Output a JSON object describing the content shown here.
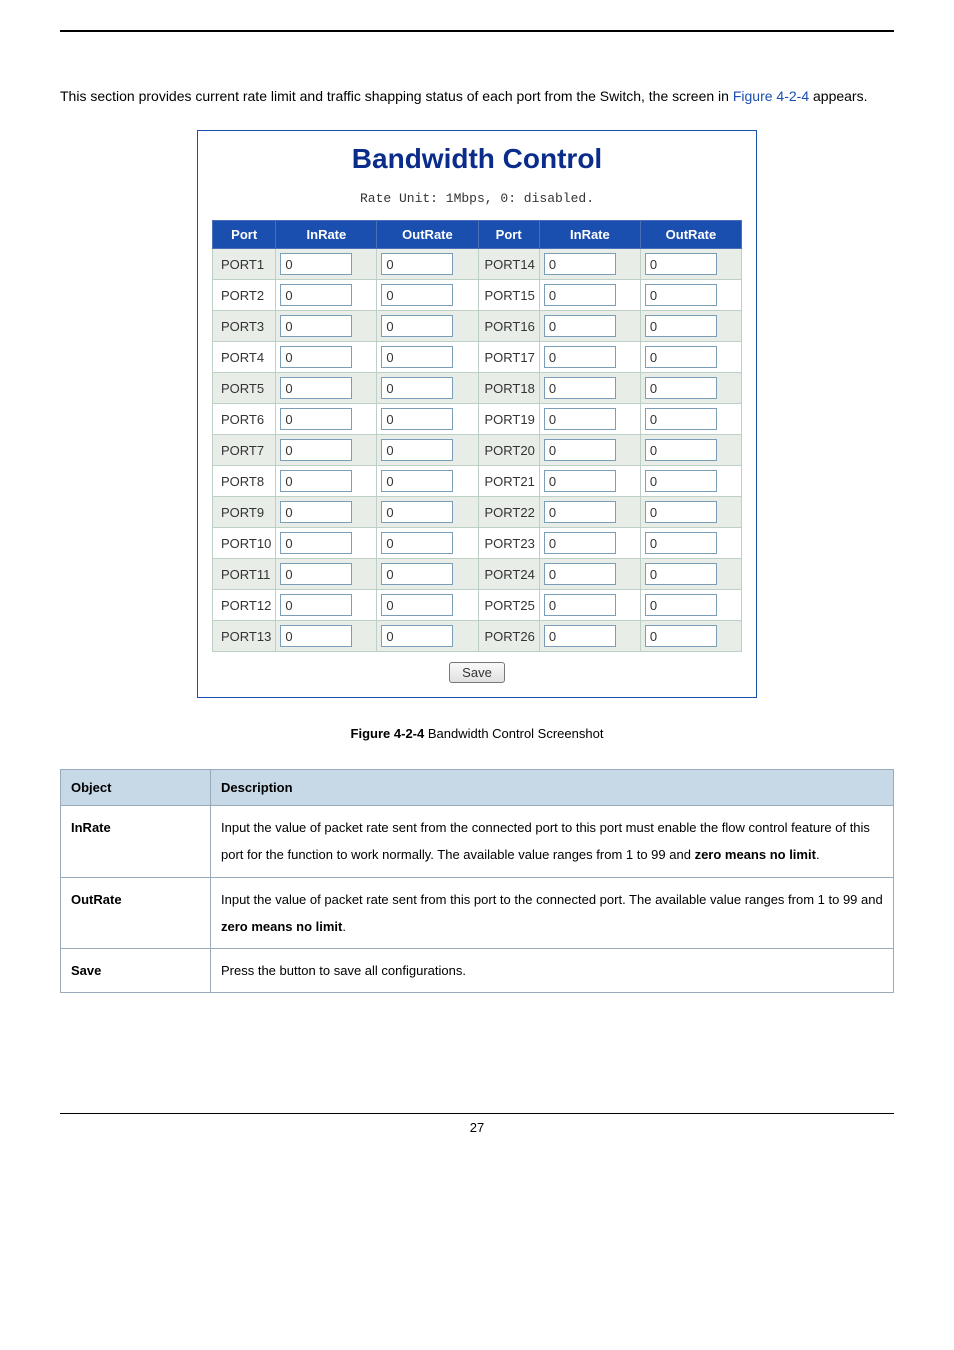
{
  "intro": {
    "prefix": "This section provides current rate limit and traffic shapping status of each port from the Switch, the screen in ",
    "figlink": "Figure 4-2-4",
    "suffix": " appears."
  },
  "panel": {
    "title": "Bandwidth Control",
    "rate_unit": "Rate Unit: 1Mbps, 0: disabled.",
    "headers": {
      "port": "Port",
      "inrate": "InRate",
      "outrate": "OutRate"
    },
    "rows_left": [
      {
        "port": "PORT1",
        "in": "0",
        "out": "0"
      },
      {
        "port": "PORT2",
        "in": "0",
        "out": "0"
      },
      {
        "port": "PORT3",
        "in": "0",
        "out": "0"
      },
      {
        "port": "PORT4",
        "in": "0",
        "out": "0"
      },
      {
        "port": "PORT5",
        "in": "0",
        "out": "0"
      },
      {
        "port": "PORT6",
        "in": "0",
        "out": "0"
      },
      {
        "port": "PORT7",
        "in": "0",
        "out": "0"
      },
      {
        "port": "PORT8",
        "in": "0",
        "out": "0"
      },
      {
        "port": "PORT9",
        "in": "0",
        "out": "0"
      },
      {
        "port": "PORT10",
        "in": "0",
        "out": "0"
      },
      {
        "port": "PORT11",
        "in": "0",
        "out": "0"
      },
      {
        "port": "PORT12",
        "in": "0",
        "out": "0"
      },
      {
        "port": "PORT13",
        "in": "0",
        "out": "0"
      }
    ],
    "rows_right": [
      {
        "port": "PORT14",
        "in": "0",
        "out": "0"
      },
      {
        "port": "PORT15",
        "in": "0",
        "out": "0"
      },
      {
        "port": "PORT16",
        "in": "0",
        "out": "0"
      },
      {
        "port": "PORT17",
        "in": "0",
        "out": "0"
      },
      {
        "port": "PORT18",
        "in": "0",
        "out": "0"
      },
      {
        "port": "PORT19",
        "in": "0",
        "out": "0"
      },
      {
        "port": "PORT20",
        "in": "0",
        "out": "0"
      },
      {
        "port": "PORT21",
        "in": "0",
        "out": "0"
      },
      {
        "port": "PORT22",
        "in": "0",
        "out": "0"
      },
      {
        "port": "PORT23",
        "in": "0",
        "out": "0"
      },
      {
        "port": "PORT24",
        "in": "0",
        "out": "0"
      },
      {
        "port": "PORT25",
        "in": "0",
        "out": "0"
      },
      {
        "port": "PORT26",
        "in": "0",
        "out": "0"
      }
    ],
    "save_label": "Save"
  },
  "fig_caption_prefix": "Figure 4-2-4",
  "fig_caption_text": " Bandwidth Control Screenshot",
  "desc_table": {
    "h_obj": "Object",
    "h_desc": "Description",
    "rows": [
      {
        "obj": "InRate",
        "desc": "Input the value of packet rate sent from the connected port to this port must enable the flow control feature of this port for the function to work normally. The available value ranges from 1 to 99 and ",
        "bold": "zero means no limit",
        "end": "."
      },
      {
        "obj": "OutRate",
        "desc": "Input the value of packet rate sent from this port to the connected port. The available value ranges from 1 to 99 and ",
        "bold": "zero means no limit",
        "end": "."
      },
      {
        "obj": "Save",
        "desc": "Press the button to save all configurations.",
        "bold": "",
        "end": ""
      }
    ]
  },
  "page_number": "27"
}
